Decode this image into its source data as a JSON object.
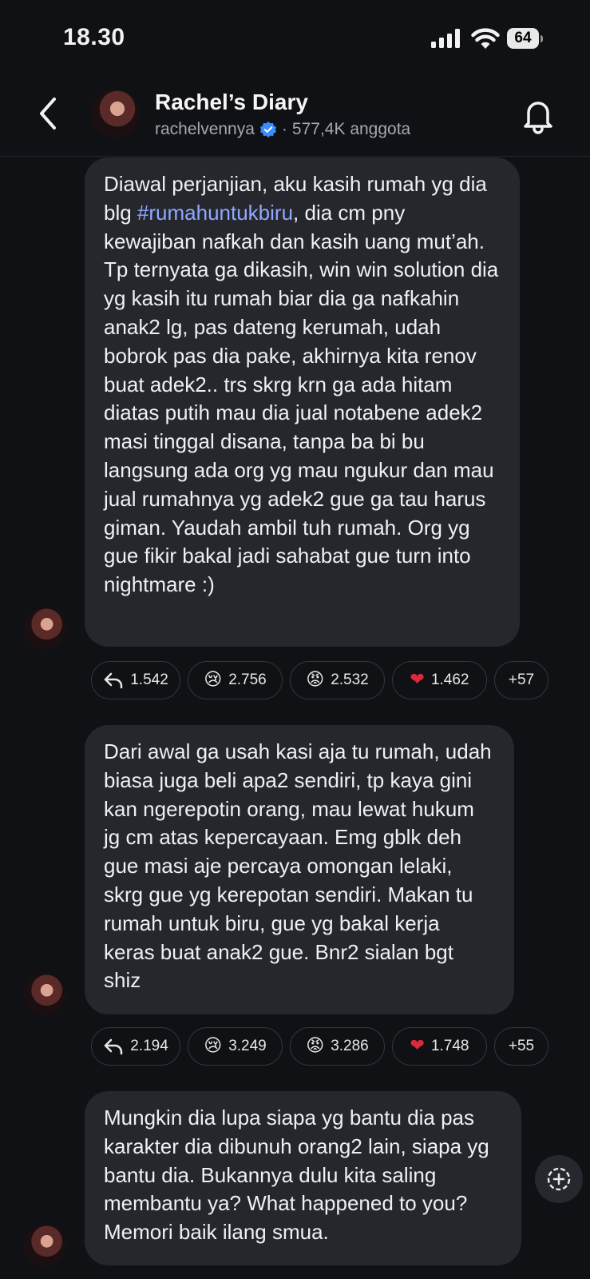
{
  "status_bar": {
    "time": "18.30",
    "battery": "64"
  },
  "header": {
    "title": "Rachel’s Diary",
    "username": "rachelvennya",
    "members": "577,4K anggota"
  },
  "messages": [
    {
      "pre": "Diawal perjanjian, aku kasih rumah yg dia blg ",
      "hashtag": "#rumahuntukbiru",
      "post": ", dia cm pny kewajiban nafkah dan kasih uang mut’ah. Tp ternyata ga dikasih, win win solution dia yg kasih itu rumah biar dia ga nafkahin anak2 lg, pas dateng kerumah, udah bobrok pas dia pake, akhirnya kita renov buat adek2.. trs skrg krn ga ada hitam diatas putih mau dia jual notabene adek2 masi tinggal disana, tanpa ba bi bu langsung ada org yg mau ngukur dan mau jual rumahnya yg adek2 gue ga tau harus giman. Yaudah ambil tuh rumah. Org yg gue fikir bakal jadi sahabat gue turn into nightmare :)",
      "reactions": {
        "replies": "1.542",
        "cry": "2.756",
        "angry": "2.532",
        "heart": "1.462",
        "more": "+57"
      }
    },
    {
      "text": "Dari awal ga usah kasi aja tu rumah, udah biasa juga beli apa2 sendiri, tp kaya gini kan ngerepotin orang, mau lewat hukum jg cm atas kepercayaan. Emg gblk deh gue masi aje percaya omongan lelaki, skrg gue yg kerepotan sendiri. Makan tu rumah untuk biru, gue yg bakal kerja keras buat anak2 gue. Bnr2 sialan bgt shiz",
      "reactions": {
        "replies": "2.194",
        "cry": "3.249",
        "angry": "3.286",
        "heart": "1.748",
        "more": "+55"
      }
    },
    {
      "text": "Mungkin dia lupa siapa yg bantu dia pas karakter dia dibunuh orang2 lain, siapa yg bantu dia. Bukannya dulu kita saling membantu ya? What happened to you? Memori baik ilang smua."
    }
  ],
  "emoji": {
    "cry": "😢",
    "angry": "😡",
    "heart": "❤"
  }
}
